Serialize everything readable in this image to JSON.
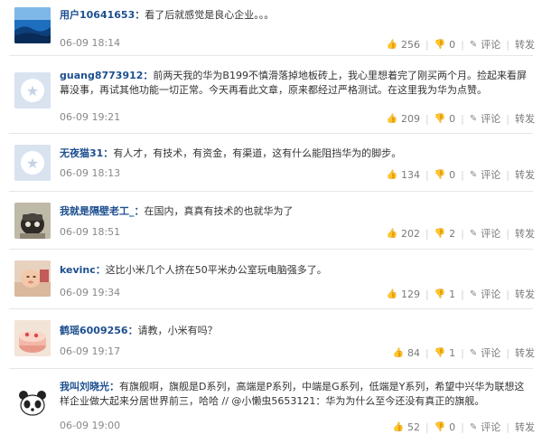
{
  "comments": [
    {
      "user": "用户10641653：",
      "text": "看了后就感觉是良心企业。。。",
      "time": "06-09 18:14",
      "likes": "256",
      "dislikes": "0",
      "reply": "评论",
      "repost": "转发",
      "avatar": "blue-landscape"
    },
    {
      "user": "guang8773912：",
      "text": "前两天我的华为B199不慎滑落掉地板砖上，我心里想着完了刚买两个月。捡起来看屏幕没事，再试其他功能一切正常。今天再看此文章，原来都经过严格测试。在这里我为华为点赞。",
      "time": "06-09 19:21",
      "likes": "209",
      "dislikes": "0",
      "reply": "评论",
      "repost": "转发",
      "avatar": "default"
    },
    {
      "user": "无夜猫31：",
      "text": "有人才，有技术，有资金，有渠道，这有什么能阻挡华为的脚步。",
      "time": "06-09 18:13",
      "likes": "134",
      "dislikes": "0",
      "reply": "评论",
      "repost": "转发",
      "avatar": "default"
    },
    {
      "user": "我就是隔壁老工_：",
      "text": "在国内，真真有技术的也就华为了",
      "time": "06-09 18:51",
      "likes": "202",
      "dislikes": "2",
      "reply": "评论",
      "repost": "转发",
      "avatar": "dark-character"
    },
    {
      "user": "kevinc：",
      "text": "这比小米几个人挤在50平米办公室玩电脑强多了。",
      "time": "06-09 19:34",
      "likes": "129",
      "dislikes": "1",
      "reply": "评论",
      "repost": "转发",
      "avatar": "baby"
    },
    {
      "user": "鹤瑶6009256：",
      "text": "请教，小米有吗？",
      "time": "06-09 19:17",
      "likes": "84",
      "dislikes": "1",
      "reply": "评论",
      "repost": "转发",
      "avatar": "cake"
    },
    {
      "user": "我叫刘晓光：",
      "text": "有旗舰啊，旗舰是D系列，高端是P系列，中端是G系列，低端是Y系列，希望中兴华为联想这样企业做大起来分居世界前三，哈哈 // @小懒虫5653121：华为为什么至今还没有真正的旗舰。",
      "time": "06-09 19:00",
      "likes": "52",
      "dislikes": "0",
      "reply": "评论",
      "repost": "转发",
      "avatar": "panda"
    }
  ]
}
